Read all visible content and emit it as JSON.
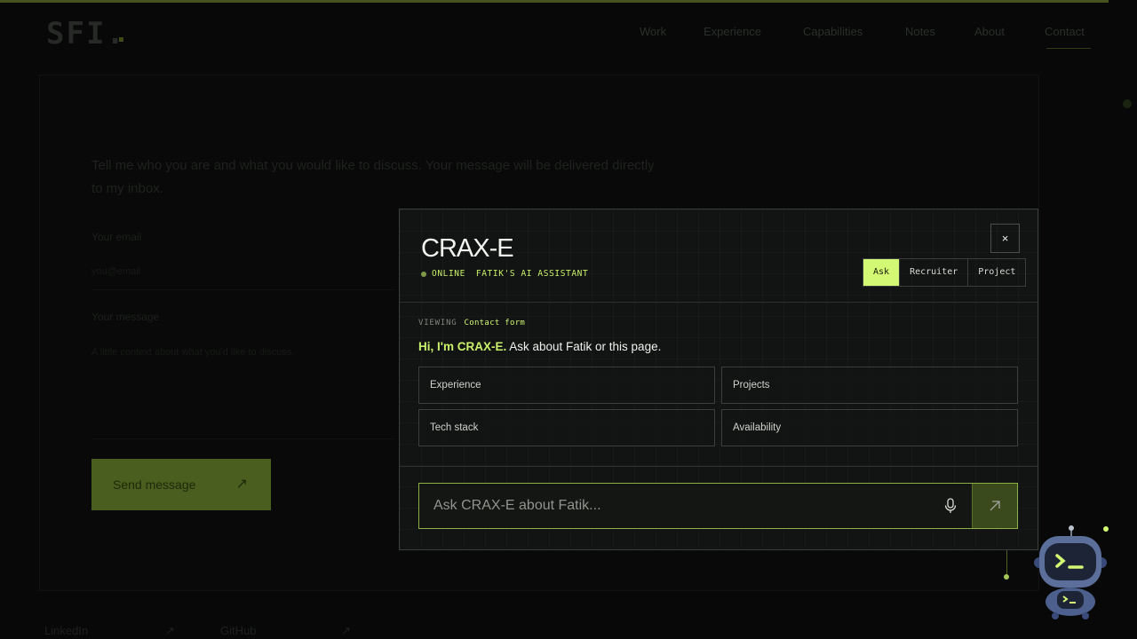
{
  "background": {
    "logo": "SFI.",
    "nav": [
      "Work",
      "Experience",
      "Capabilities",
      "Notes",
      "About",
      "Contact"
    ],
    "eyebrow": "",
    "intro": "Tell me who you are and what you would like to discuss. Your message will be delivered directly to my inbox.",
    "fields": [
      {
        "label": "Your email",
        "placeholder": "you@email"
      },
      {
        "label": "Your message",
        "placeholder": "A little context about what you'd like to discuss."
      }
    ],
    "send_label": "Send message",
    "footer_links": [
      "LinkedIn",
      "GitHub"
    ]
  },
  "assistant": {
    "title": "CRAX-E",
    "status": "ONLINE",
    "subtitle": "FATIK'S AI ASSISTANT",
    "close_label": "×",
    "tabs": [
      {
        "label": "Ask",
        "active": true
      },
      {
        "label": "Recruiter",
        "active": false
      },
      {
        "label": "Project",
        "active": false
      }
    ],
    "viewing_label": "VIEWING",
    "viewing_value": "Contact form",
    "greeting_strong": "Hi, I'm CRAX-E.",
    "greeting_rest": " Ask about Fatik or this page.",
    "suggestions": [
      "Experience",
      "Projects",
      "Tech stack",
      "Availability"
    ],
    "input_placeholder": "Ask CRAX-E about Fatik...",
    "input_value": ""
  },
  "colors": {
    "accent": "#d3f873",
    "accent_dim": "#8dae46",
    "panel": "#121413",
    "page": "#070807"
  },
  "icons": {
    "mic": "microphone-icon",
    "send": "arrow-up-right-icon",
    "close": "close-icon",
    "mascot": "robot-icon"
  }
}
